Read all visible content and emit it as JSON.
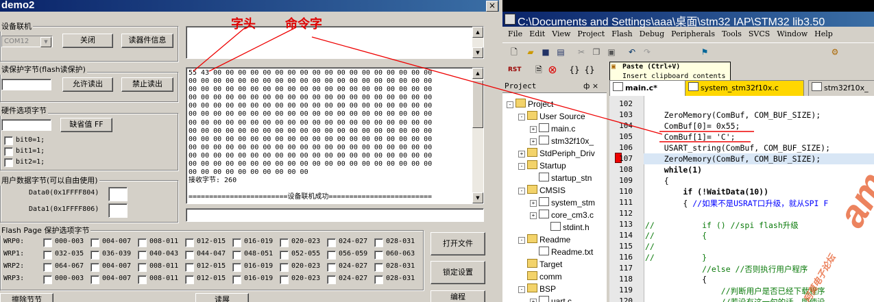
{
  "left": {
    "title": "demo2",
    "close_glyph": "×",
    "device_group": "设备联机",
    "com_value": "COM12",
    "close_btn": "关闭",
    "device_info_btn": "读器件信息",
    "read_protect_group": "读保护字节(flash读保护)",
    "allow_read_btn": "允许读出",
    "deny_read_btn": "禁止读出",
    "hw_option_group": "硬件选项字节",
    "default_ff_btn": "缺省值 FF",
    "bits": [
      "bit0=1;",
      "bit1=1;",
      "bit2=1;"
    ],
    "user_data_group": "用户数据字节(可以自由使用)",
    "data0_label": "Data0(0x1FFFF804)",
    "data1_label": "Data1(0x1FFFF806)",
    "flash_group": "Flash Page 保护选项字节",
    "wrp_rows": [
      {
        "label": "WRP0:",
        "items": [
          "000-003",
          "004-007",
          "008-011",
          "012-015",
          "016-019",
          "020-023",
          "024-027",
          "028-031"
        ]
      },
      {
        "label": "WRP1:",
        "items": [
          "032-035",
          "036-039",
          "040-043",
          "044-047",
          "048-051",
          "052-055",
          "056-059",
          "060-063"
        ]
      },
      {
        "label": "WRP2:",
        "items": [
          "064-067",
          "004-007",
          "008-011",
          "012-015",
          "016-019",
          "020-023",
          "024-027",
          "028-031"
        ]
      },
      {
        "label": "WRP3:",
        "items": [
          "000-003",
          "004-007",
          "008-011",
          "012-015",
          "016-019",
          "020-023",
          "024-027",
          "028-031"
        ]
      }
    ],
    "open_file_btn": "打开文件",
    "lock_btn": "锁定设置",
    "bottom_btn1": "擦除节节",
    "bottom_btn2": "读展",
    "bottom_btn3": "编程",
    "hex_first_line": "55 43 00 00 00 00 00 00 00 00 00 00 00 00 00 00 00 00 00 00",
    "hex_line": "00 00 00 00 00 00 00 00 00 00 00 00 00 00 00 00 00 00 00 00",
    "hex_last_line": "00 00 00 00 00 00 00 00 00 00",
    "received": "接收字节: 260",
    "connected": "========================设备联机成功=========================",
    "annot_header": "字头",
    "annot_cmd": "命令字"
  },
  "right": {
    "title": "C:\\Documents and Settings\\aaa\\桌面\\stm32 IAP\\STM32 lib3.50",
    "menu": [
      "File",
      "Edit",
      "View",
      "Project",
      "Flash",
      "Debug",
      "Peripherals",
      "Tools",
      "SVCS",
      "Window",
      "Help"
    ],
    "tooltip_title": "Paste (Ctrl+V)",
    "tooltip_desc": "Insert clipboard contents",
    "project_label": "Project",
    "pane_pin": "ф ×",
    "tabs": [
      "main.c*",
      "system_stm32f10x.c",
      "stm32f10x_"
    ],
    "tree": [
      {
        "indent": 0,
        "pm": "-",
        "icon": "folder",
        "text": "Project"
      },
      {
        "indent": 1,
        "pm": "-",
        "icon": "folder",
        "text": "User Source"
      },
      {
        "indent": 2,
        "pm": "+",
        "icon": "file",
        "text": "main.c"
      },
      {
        "indent": 2,
        "pm": "+",
        "icon": "file",
        "text": "stm32f10x_"
      },
      {
        "indent": 1,
        "pm": "+",
        "icon": "folder",
        "text": "StdPeriph_Driv"
      },
      {
        "indent": 1,
        "pm": "-",
        "icon": "folder",
        "text": "Startup"
      },
      {
        "indent": 2,
        "pm": "",
        "icon": "file",
        "text": "startup_stn"
      },
      {
        "indent": 1,
        "pm": "-",
        "icon": "folder",
        "text": "CMSIS"
      },
      {
        "indent": 2,
        "pm": "+",
        "icon": "file",
        "text": "system_stm"
      },
      {
        "indent": 2,
        "pm": "+",
        "icon": "file",
        "text": "core_cm3.c"
      },
      {
        "indent": 3,
        "pm": "",
        "icon": "file",
        "text": "stdint.h"
      },
      {
        "indent": 1,
        "pm": "-",
        "icon": "folder",
        "text": "Readme"
      },
      {
        "indent": 2,
        "pm": "",
        "icon": "file",
        "text": "Readme.txt"
      },
      {
        "indent": 1,
        "pm": "",
        "icon": "folder",
        "text": "Target"
      },
      {
        "indent": 1,
        "pm": "",
        "icon": "folder",
        "text": "comm"
      },
      {
        "indent": 1,
        "pm": "-",
        "icon": "folder",
        "text": "BSP"
      },
      {
        "indent": 2,
        "pm": "+",
        "icon": "file",
        "text": "uart.c"
      }
    ],
    "code_lines": [
      {
        "n": "102",
        "t": ""
      },
      {
        "n": "103",
        "t": "    ZeroMemory(ComBuf, COM_BUF_SIZE);"
      },
      {
        "n": "104",
        "t": "    ComBuf[0]= 0x55;"
      },
      {
        "n": "105",
        "t": "    ComBuf[1]= 'C';"
      },
      {
        "n": "106",
        "t": "    USART_string(ComBuf, COM_BUF_SIZE);"
      },
      {
        "n": "107",
        "t": "    ZeroMemory(ComBuf, COM_BUF_SIZE);"
      },
      {
        "n": "108",
        "t": "    while(1)"
      },
      {
        "n": "109",
        "t": "    {"
      },
      {
        "n": "110",
        "t": "        if (!WaitData(10))"
      },
      {
        "n": "111",
        "t": "        { //如果不是USRAT口升级，就从SPI F"
      },
      {
        "n": "112",
        "t": ""
      },
      {
        "n": "113",
        "t": "//          if () //spi flash升级"
      },
      {
        "n": "114",
        "t": "//          {"
      },
      {
        "n": "115",
        "t": "//"
      },
      {
        "n": "116",
        "t": "//          }"
      },
      {
        "n": "117",
        "t": "            //else //否则执行用户程序"
      },
      {
        "n": "118",
        "t": "            {"
      },
      {
        "n": "119",
        "t": "                //判断用户是否已经下载程序"
      },
      {
        "n": "120",
        "t": "                //若没有这一句的话，即使没"
      }
    ],
    "watermark": "amoBBS",
    "watermark_sub": "阿莫电子论坛"
  }
}
